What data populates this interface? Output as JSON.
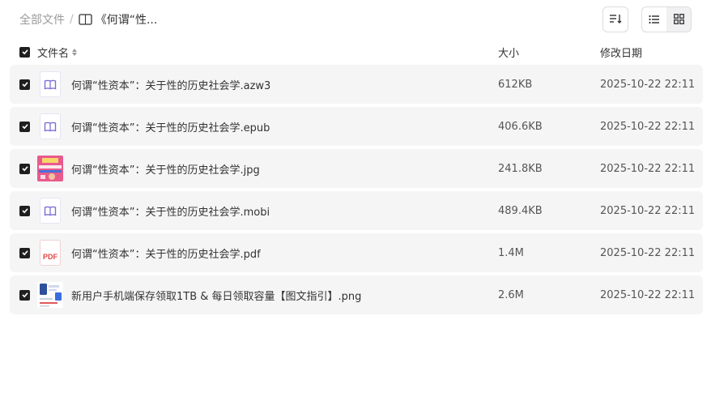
{
  "breadcrumb": {
    "root": "全部文件",
    "separator": "/",
    "current": "《何谓“性..."
  },
  "toolbar": {
    "sort_icon": "sort-lines-icon",
    "list_view_icon": "list-view-icon",
    "grid_view_icon": "grid-view-icon",
    "active_view": "list"
  },
  "table": {
    "columns": {
      "name": "文件名",
      "size": "大小",
      "date": "修改日期"
    },
    "rows": [
      {
        "name": "何谓“性资本”：关于性的历史社会学.azw3",
        "size": "612KB",
        "date": "2025-10-22 22:11",
        "icon": "ebook-icon",
        "checked": true
      },
      {
        "name": "何谓“性资本”：关于性的历史社会学.epub",
        "size": "406.6KB",
        "date": "2025-10-22 22:11",
        "icon": "ebook-icon",
        "checked": true
      },
      {
        "name": "何谓“性资本”：关于性的历史社会学.jpg",
        "size": "241.8KB",
        "date": "2025-10-22 22:11",
        "icon": "image-thumbnail",
        "checked": true
      },
      {
        "name": "何谓“性资本”：关于性的历史社会学.mobi",
        "size": "489.4KB",
        "date": "2025-10-22 22:11",
        "icon": "ebook-icon",
        "checked": true
      },
      {
        "name": "何谓“性资本”：关于性的历史社会学.pdf",
        "size": "1.4M",
        "date": "2025-10-22 22:11",
        "icon": "pdf-icon",
        "pdf_label": "PDF",
        "checked": true
      },
      {
        "name": "新用户手机端保存领取1TB & 每日领取容量【图文指引】.png",
        "size": "2.6M",
        "date": "2025-10-22 22:11",
        "icon": "image-thumbnail",
        "checked": true
      }
    ]
  },
  "colors": {
    "row_bg": "#f5f5f6",
    "checkbox": "#1f1f1f",
    "ebook_icon": "#7b6fd6",
    "pdf_red": "#e04444"
  }
}
